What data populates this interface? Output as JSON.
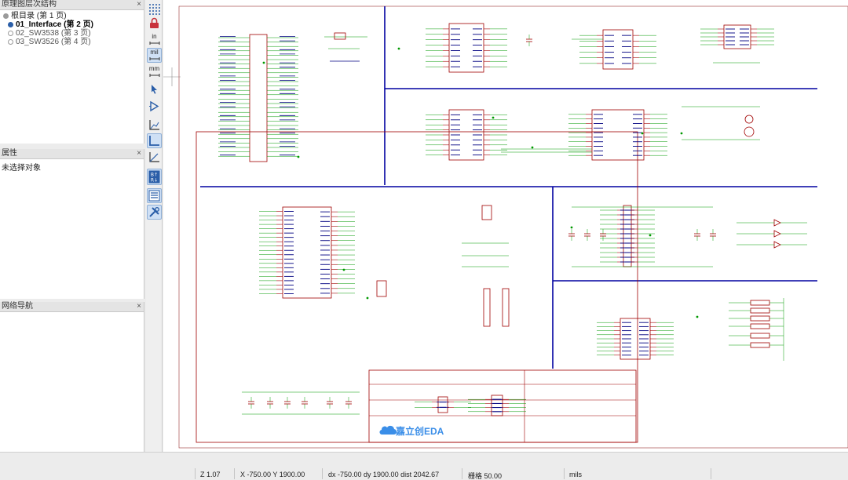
{
  "hierarchy_panel": {
    "title": "原理图层次结构",
    "close": "×",
    "root": "根目录 (第 1 页)",
    "sheets": [
      {
        "label": "01_Interface (第 2 页)",
        "active": true
      },
      {
        "label": "02_SW3538 (第 3 页)",
        "active": false
      },
      {
        "label": "03_SW3526 (第 4 页)",
        "active": false
      }
    ]
  },
  "properties_panel": {
    "title": "属性",
    "close": "×",
    "empty_text": "未选择对象"
  },
  "navigator_panel": {
    "title": "网络导航",
    "close": "×"
  },
  "toolbar": {
    "unit_in": "in",
    "unit_mil": "mil",
    "unit_mm": "mm",
    "icons": [
      "grid-dots-icon",
      "lock-icon",
      "unit-in-icon",
      "unit-mil-icon",
      "unit-mm-icon",
      "pointer-icon",
      "net-flag-icon",
      "axis-icon",
      "axis-selected-icon",
      "axis-angle-icon",
      "sort-icon",
      "list-icon",
      "tools-icon"
    ]
  },
  "schematic": {
    "logo_text": "嘉立创EDA",
    "colors": {
      "wire": "#009900",
      "part": "#a00000",
      "pin_label": "#000080",
      "divider": "#0000a0",
      "canvas": "#ffffff"
    }
  },
  "statusbar": {
    "zoom": "Z 1.07",
    "cursor": "X -750.00  Y 1900.00",
    "delta": "dx -750.00  dy 1900.00  dist 2042.67",
    "grid": "栅格 50.00",
    "units": "mils"
  }
}
